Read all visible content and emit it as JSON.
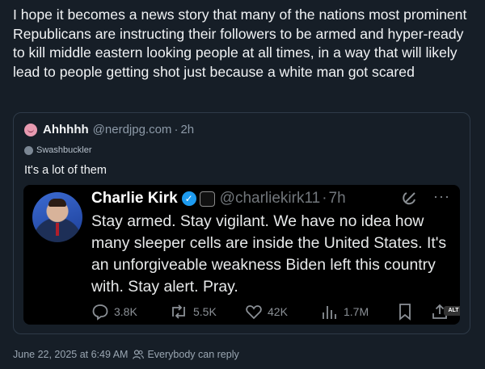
{
  "post": {
    "text": "I hope it becomes a news story that many of the nations most prominent Republicans are instructing their followers to be armed and hyper-ready to kill middle eastern looking people at all times, in a way that will likely lead to people getting shot just because a white man got scared",
    "date": "June 22, 2025 at 6:49 AM",
    "reply_setting": "Everybody can reply"
  },
  "quote": {
    "author_name": "Ahhhhh",
    "author_handle": "@nerdjpg.com",
    "separator": "·",
    "time": "2h",
    "sub_label": "Swashbuckler",
    "text": "It's a lot of them"
  },
  "embedded_tweet": {
    "author_name": "Charlie Kirk",
    "verified_glyph": "✓",
    "affiliate_badge": "TPUSA",
    "author_handle": "@charliekirk11",
    "separator": "·",
    "time": "7h",
    "more": "···",
    "text": "Stay armed. Stay vigilant. We have no idea how many sleeper cells are inside the United States. It's an unforgiveable weakness Biden left this country with. Stay alert. Pray.",
    "replies": "3.8K",
    "reposts": "5.5K",
    "likes": "42K",
    "views": "1.7M",
    "alt_label": "ALT"
  },
  "colors": {
    "background": "#161e27",
    "verified": "#1d9bf0",
    "muted": "#9aa6b2"
  },
  "icons": [
    "emoji-avatar-icon",
    "swashbuckler-icon",
    "verified-icon",
    "grok-icon",
    "more-icon",
    "reply-icon",
    "repost-icon",
    "like-icon",
    "views-icon",
    "bookmark-icon",
    "share-icon",
    "people-icon"
  ]
}
